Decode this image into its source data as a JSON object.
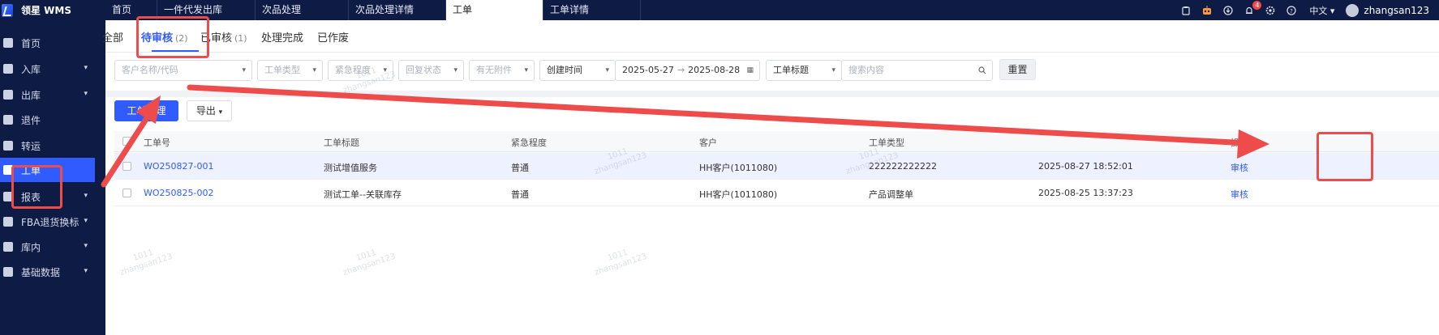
{
  "app": {
    "title": "领星 WMS"
  },
  "top_tabs": [
    {
      "label": "首页",
      "width": 64
    },
    {
      "label": "一件代发出库",
      "width": 121
    },
    {
      "label": "次品处理",
      "width": 115
    },
    {
      "label": "次品处理详情",
      "width": 120
    },
    {
      "label": "工单",
      "width": 120,
      "active": true
    },
    {
      "label": "工单详情",
      "width": 120
    }
  ],
  "header_right": {
    "icons": [
      "clipboard-icon",
      "robot-icon",
      "download-icon",
      "bell-icon",
      "gear-icon",
      "help-icon"
    ],
    "notification_count": "4",
    "language": "中文",
    "username": "zhangsan123"
  },
  "sidebar": {
    "items": [
      {
        "label": "首页",
        "icon": "home-icon",
        "has_children": false
      },
      {
        "label": "入库",
        "icon": "inbound-icon",
        "has_children": true
      },
      {
        "label": "出库",
        "icon": "outbound-icon",
        "has_children": true
      },
      {
        "label": "退件",
        "icon": "return-icon",
        "has_children": false
      },
      {
        "label": "转运",
        "icon": "transfer-icon",
        "has_children": false
      },
      {
        "label": "工单",
        "icon": "work-order-icon",
        "has_children": false,
        "active": true
      },
      {
        "label": "报表",
        "icon": "report-icon",
        "has_children": true
      },
      {
        "label": "FBA退货换标",
        "icon": "fba-icon",
        "has_children": true
      },
      {
        "label": "库内",
        "icon": "warehouse-icon",
        "has_children": true
      },
      {
        "label": "基础数据",
        "icon": "data-icon",
        "has_children": true
      }
    ]
  },
  "status_tabs": [
    {
      "label": "全部"
    },
    {
      "label": "待审核",
      "count": "(2)",
      "active": true
    },
    {
      "label": "已审核",
      "count": "(1)"
    },
    {
      "label": "处理完成"
    },
    {
      "label": "已作废"
    }
  ],
  "filters": {
    "customer": "客户名称/代码",
    "type": "工单类型",
    "urgency": "紧急程度",
    "reply_status": "回复状态",
    "attachment": "有无附件",
    "time_field": "创建时间",
    "date_start": "2025-05-27",
    "date_arrow": "→",
    "date_end": "2025-08-28",
    "search_field": "工单标题",
    "search_placeholder": "搜索内容",
    "reset": "重置"
  },
  "actions": {
    "primary": "工单管理",
    "export": "导出"
  },
  "table": {
    "headers": [
      "工单号",
      "工单标题",
      "紧急程度",
      "客户",
      "工单类型",
      "操作"
    ],
    "rows": [
      {
        "id": "WO250827-001",
        "title": "测试增值服务",
        "urgency": "普通",
        "customer": "HH客户(1011080)",
        "type": "222222222222",
        "time": "2025-08-27 18:52:01",
        "action": "审核"
      },
      {
        "id": "WO250825-002",
        "title": "测试工单--关联库存",
        "urgency": "普通",
        "customer": "HH客户(1011080)",
        "type": "产品调整单",
        "time": "2025-08-25 13:37:23",
        "action": "审核"
      }
    ]
  },
  "watermark": {
    "line1": "1011",
    "line2": "zhangsan123"
  },
  "colors": {
    "nav_bg": "#0e1b45",
    "accent": "#2f5bff",
    "annotation": "#ee4b4b"
  }
}
